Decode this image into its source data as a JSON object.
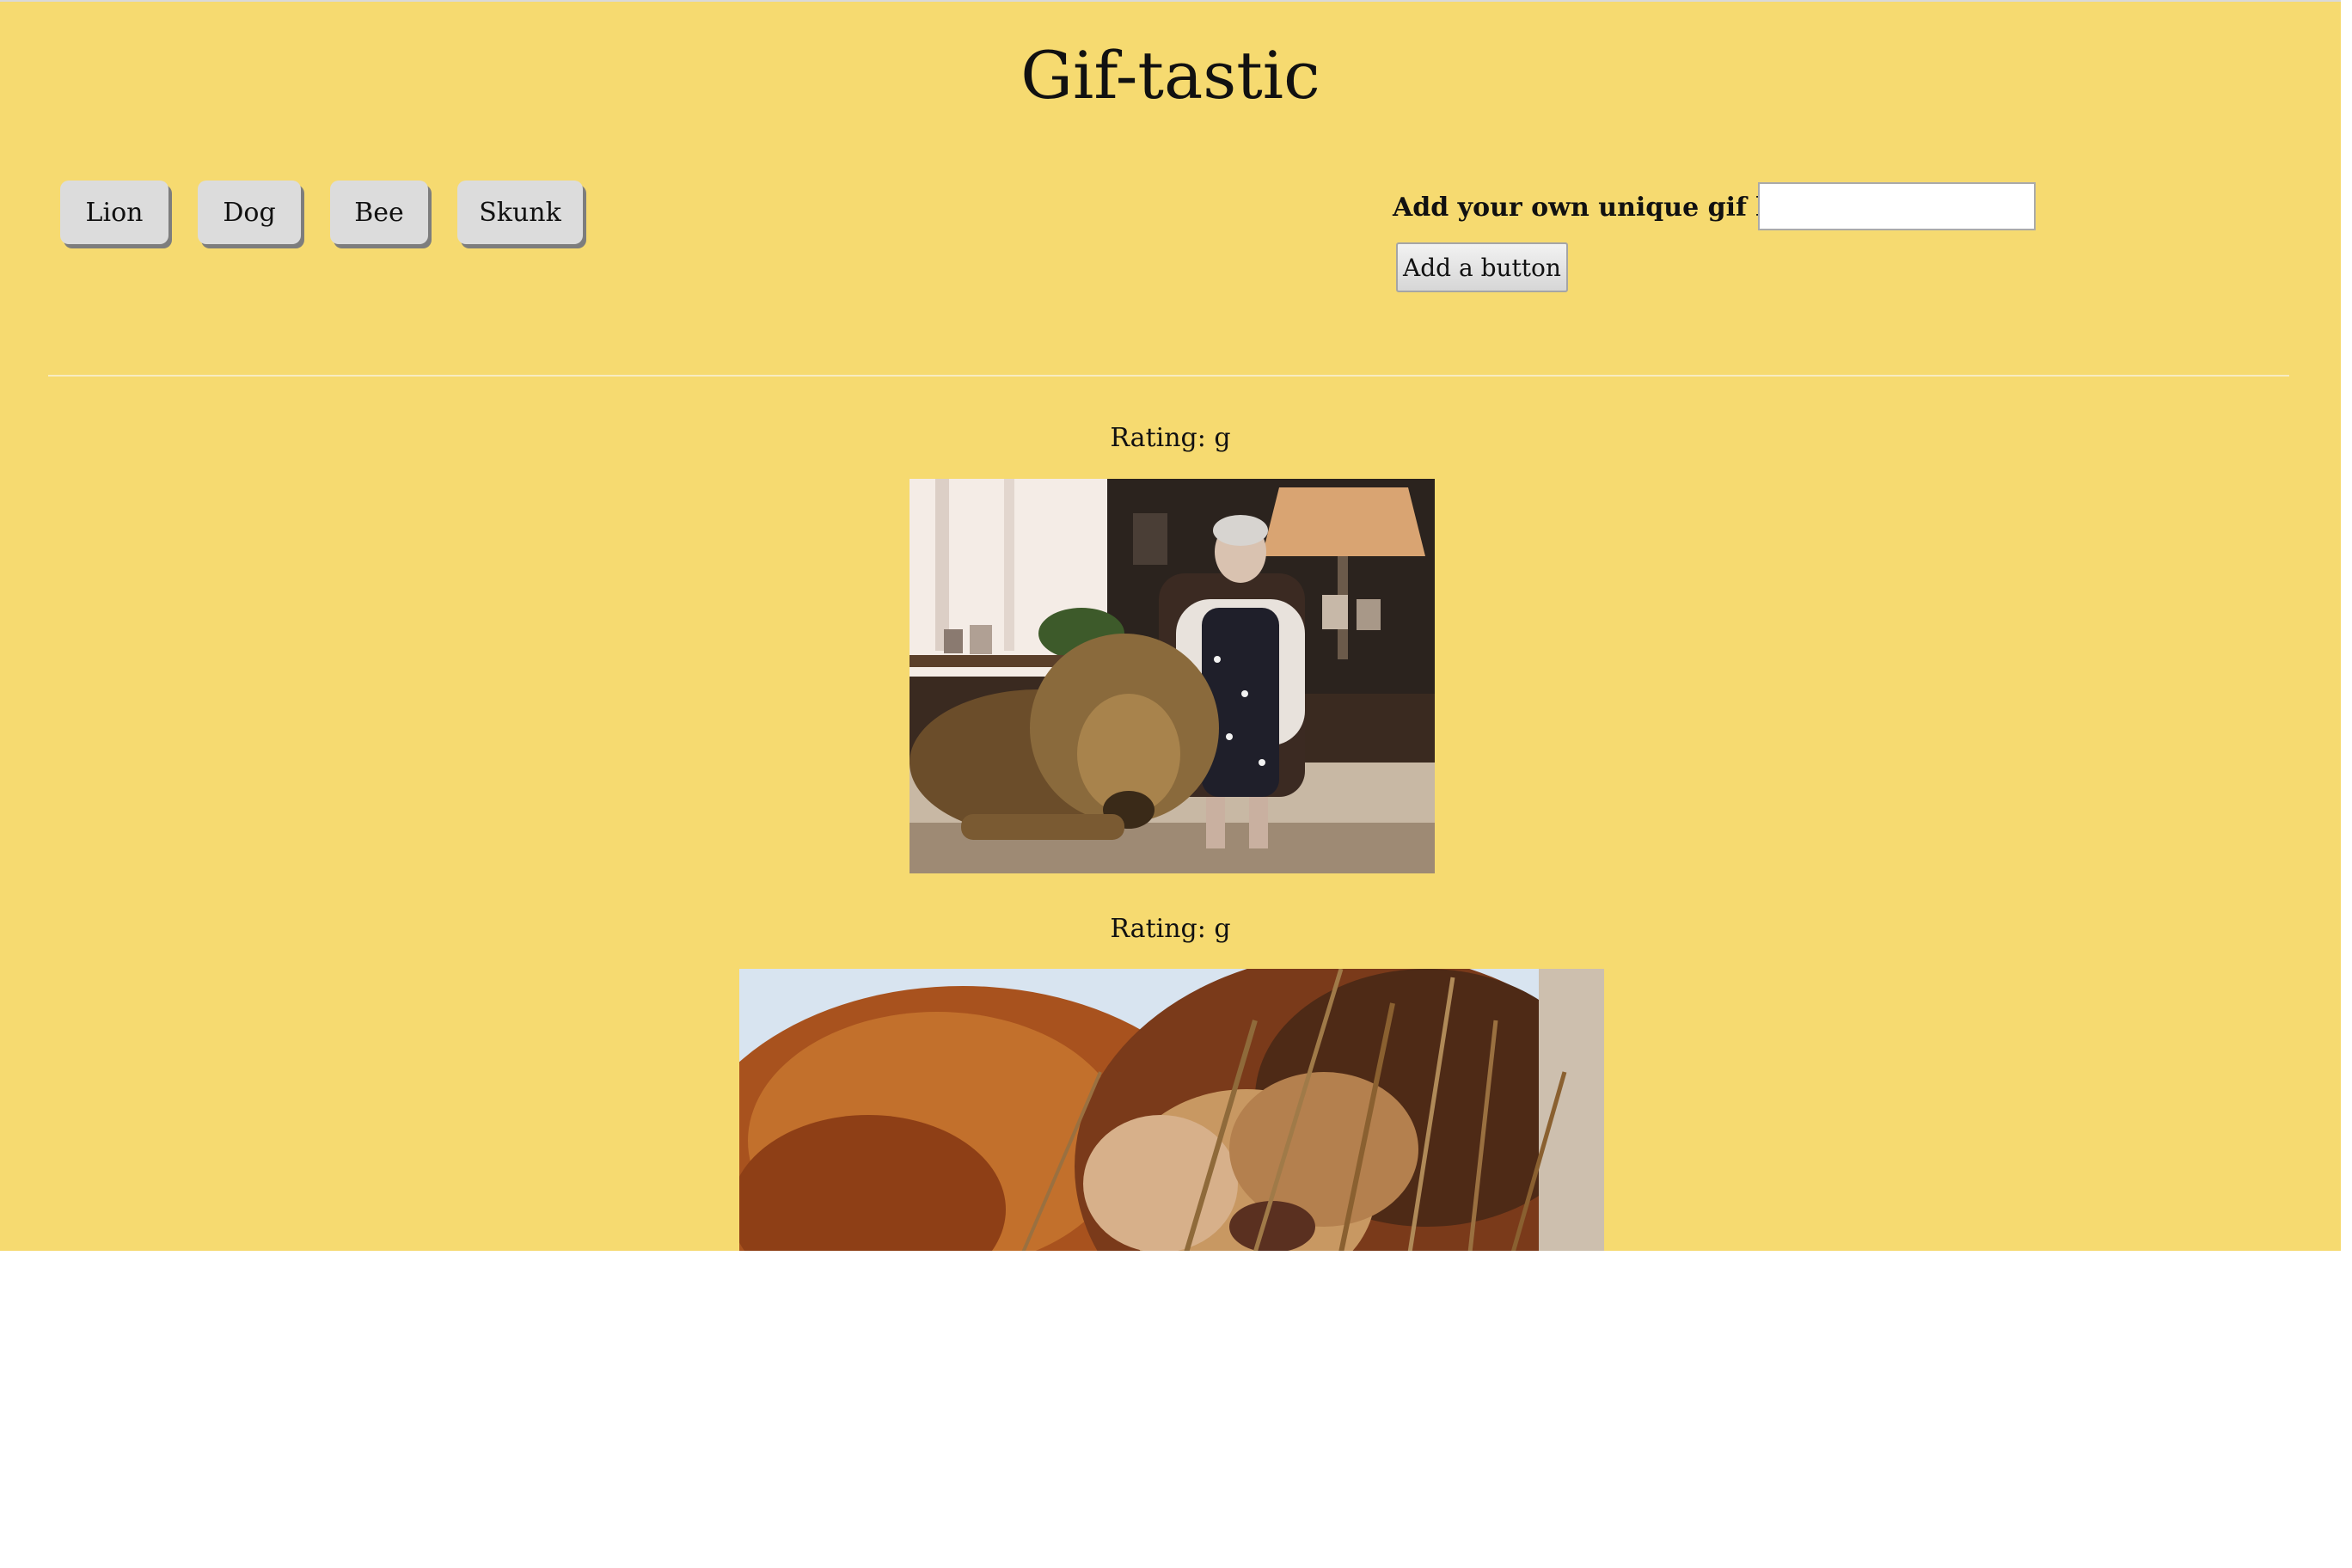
{
  "page": {
    "title": "Gif-tastic"
  },
  "topics": {
    "buttons": [
      {
        "label": "Lion"
      },
      {
        "label": "Dog"
      },
      {
        "label": "Bee"
      },
      {
        "label": "Skunk"
      }
    ]
  },
  "add_form": {
    "label": "Add your own unique gif button:",
    "input_value": "",
    "submit_label": "Add a button"
  },
  "gifs": [
    {
      "rating_text": "Rating: g",
      "image_subject": "lion-beside-seated-woman"
    },
    {
      "rating_text": "Rating: g",
      "image_subject": "lions-nuzzling-in-grass"
    }
  ],
  "colors": {
    "background": "#f6da70",
    "button_face": "#dcdcdc",
    "button_shadow": "#7d7d7d"
  }
}
